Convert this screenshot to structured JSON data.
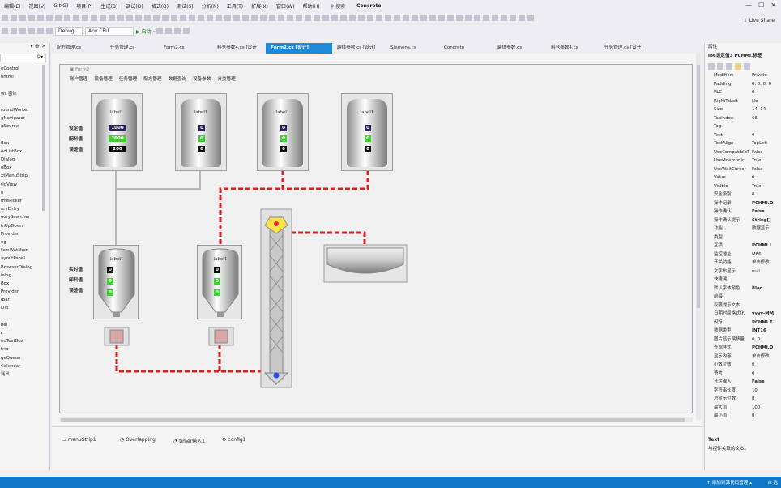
{
  "menubar": {
    "items": [
      "编辑(E)",
      "视图(V)",
      "Git(G)",
      "项目(P)",
      "生成(B)",
      "调试(D)",
      "格式(O)",
      "测试(S)",
      "分析(N)",
      "工具(T)",
      "扩展(X)",
      "窗口(W)",
      "帮助(H)"
    ],
    "search": "搜索",
    "project": "Concrete"
  },
  "toolbar": {
    "config": "Debug",
    "platform": "Any CPU",
    "start": "▶ 启动 ·",
    "liveshare": "Live Share"
  },
  "tabs": [
    "配方管理.cs",
    "任务管理.cs",
    "Form2.cs",
    "料仓参数4.cs [设计]",
    "Form2.cs [设计]",
    "罐体参数.cs [设计]",
    "Siemens.cs",
    "Concrete",
    "罐体参数.cs",
    "料仓参数4.cs",
    "任务管理.cs [设计]"
  ],
  "active_tab_index": 4,
  "left_panel": {
    "pin": "▾ ⊕ ✕",
    "search_icon": "search-icon",
    "items": [
      "eControl",
      "ontrol",
      "",
      "ws 窗体",
      "",
      "roundWorker",
      "gNavigator",
      "gSource",
      "",
      "Box",
      "edListBox",
      "Dialog",
      "oBox",
      "xtMenuStrip",
      "ridView",
      "e",
      "imePicker",
      "oryEntry",
      "oorySearcher",
      "inUpDown",
      "Provider",
      "og",
      "temWatcher",
      "ayoutPanel",
      "BrowserDialog",
      "ialog",
      "Box",
      "Provider",
      "lBar",
      "List",
      "",
      "bel",
      "r",
      "edTextBox",
      "trip",
      "geQueue",
      "Calendar",
      "耗出"
    ]
  },
  "form": {
    "title": "Form2",
    "menu": [
      "账户管理",
      "设备管理",
      "任务管理",
      "配方管理",
      "数据查询",
      "设备参数",
      "分类管理"
    ],
    "label_text": "label1",
    "upper_tank_values": [
      [
        "1000",
        "2000",
        "200"
      ],
      [
        "0",
        "0",
        "0"
      ],
      [
        "0",
        "0",
        "0"
      ],
      [
        "0",
        "0",
        "0"
      ]
    ],
    "upper_side_labels": [
      "设定值",
      "配料值",
      "误差值"
    ],
    "lower_tank_values": [
      [
        "0",
        "0",
        "0"
      ],
      [
        "0",
        "0",
        "0"
      ]
    ],
    "lower_side_labels": [
      "实时值",
      "卸料值",
      "误差值"
    ]
  },
  "components": [
    "menuStrip1",
    "Overlapping",
    "timer输入1",
    "config1"
  ],
  "properties": [
    {
      "k": "Modifiers",
      "v": "Private"
    },
    {
      "k": "Padding",
      "v": "0, 0, 0, 0"
    },
    {
      "k": "PLC",
      "v": "0"
    },
    {
      "k": "RightToLeft",
      "v": "No"
    },
    {
      "k": "Size",
      "v": "14, 14"
    },
    {
      "k": "TabIndex",
      "v": "66"
    },
    {
      "k": "Tag",
      "v": ""
    },
    {
      "k": "Text",
      "v": "0"
    },
    {
      "k": "TextAlign",
      "v": "TopLeft"
    },
    {
      "k": "UseCompatibleT",
      "v": "False"
    },
    {
      "k": "UseMnemonic",
      "v": "True"
    },
    {
      "k": "UseWaitCursor",
      "v": "False"
    },
    {
      "k": "Value",
      "v": "0"
    },
    {
      "k": "Visible",
      "v": "True"
    },
    {
      "k": "安全级别",
      "v": "0"
    },
    {
      "k": "操作记录",
      "v": "PCHMI.O",
      "b": true
    },
    {
      "k": "操作确认",
      "v": "False",
      "b": true
    },
    {
      "k": "操作确认提示",
      "v": "String[]",
      "b": true
    },
    {
      "k": "功能",
      "v": "数据显示"
    },
    {
      "k": "类型",
      "v": ""
    },
    {
      "k": "互锁",
      "v": "PCHMI.I",
      "b": true
    },
    {
      "k": "监控地址",
      "v": "M66"
    },
    {
      "k": "开关功能",
      "v": "单击修改"
    },
    {
      "k": "文字布显示",
      "v": "null"
    },
    {
      "k": "快捷键",
      "v": ""
    },
    {
      "k": "默认字体颜色",
      "v": "Blac",
      "b": true
    },
    {
      "k": "前缀",
      "v": ""
    },
    {
      "k": "权限提示文本",
      "v": ""
    },
    {
      "k": "日期时间格式化",
      "v": "yyyy-MM",
      "b": true
    },
    {
      "k": "闪烁",
      "v": "PCHMI.F",
      "b": true
    },
    {
      "k": "数据类型",
      "v": "INT16",
      "b": true
    },
    {
      "k": "图片显示偏移量",
      "v": "0, 0"
    },
    {
      "k": "外观样式",
      "v": "PCHMI.D",
      "b": true
    },
    {
      "k": "显示内容",
      "v": "单击修改"
    },
    {
      "k": "小数位数",
      "v": "0"
    },
    {
      "k": "语言",
      "v": "0"
    },
    {
      "k": "允许输入",
      "v": "False",
      "b": true
    },
    {
      "k": "字符串长度",
      "v": "10"
    },
    {
      "k": "总显示位数",
      "v": "8"
    },
    {
      "k": "最大值",
      "v": "100"
    },
    {
      "k": "最小值",
      "v": "0"
    }
  ],
  "props_header": "lb6设定值3 PCHMI.标签",
  "props_title": "属性",
  "props_desc_title": "Text",
  "props_desc": "与控件关联的文本。",
  "statusbar": {
    "left_text": "↑ 添加到源代码管理 ▴",
    "right_text": "⊞ 选"
  }
}
